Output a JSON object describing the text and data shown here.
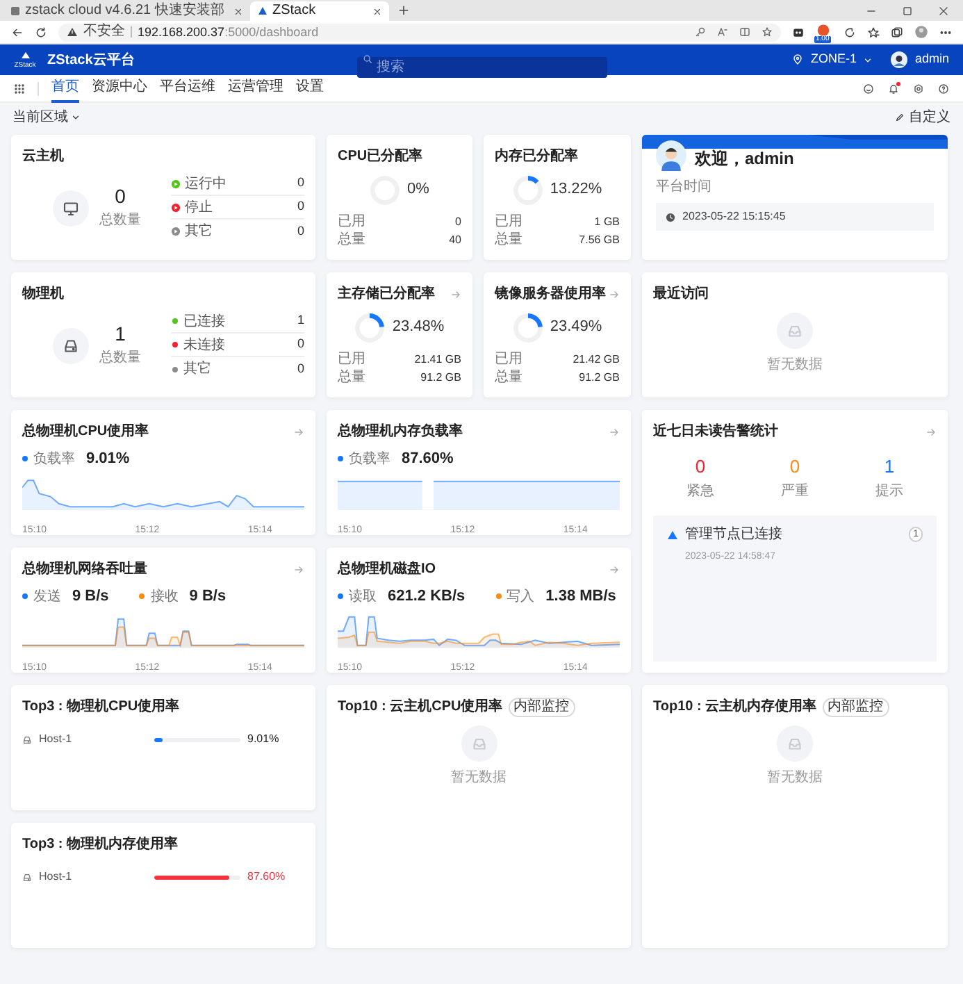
{
  "browser": {
    "tabs": [
      {
        "title": "zstack cloud v4.6.21 快速安装部",
        "selected": false
      },
      {
        "title": "ZStack",
        "selected": true
      }
    ],
    "security": "不安全",
    "url_host": "192.168.200.37",
    "url_path": ":5000/dashboard",
    "extension_badge": "1.00"
  },
  "header": {
    "logo_text": "ZStack",
    "product": "ZStack云平台",
    "search_placeholder": "搜索",
    "zone": "ZONE-1",
    "user": "admin",
    "unread_notifications": true
  },
  "nav": [
    {
      "label": "首页",
      "selected": true
    },
    {
      "label": "资源中心",
      "selected": false
    },
    {
      "label": "平台运维",
      "selected": false
    },
    {
      "label": "运营管理",
      "selected": false
    },
    {
      "label": "设置",
      "selected": false
    }
  ],
  "toolbar": {
    "region": "当前区域",
    "customize": "自定义"
  },
  "cards": [
    {
      "kind": "vm_summary",
      "title": "云主机",
      "total": "0",
      "total_label": "总数量",
      "statuses": [
        {
          "label": "运行中",
          "value": "0",
          "color": "#52c41a"
        },
        {
          "label": "停止",
          "value": "0",
          "color": "#f5222d"
        },
        {
          "label": "其它",
          "value": "0",
          "color": "#8c8c8c"
        }
      ]
    },
    {
      "kind": "allocation",
      "title": "CPU已分配率",
      "arrow": false,
      "level": 0,
      "percent": "0%",
      "rows": [
        {
          "label": "已用",
          "value": "0"
        },
        {
          "label": "总量",
          "value": "40"
        }
      ]
    },
    {
      "kind": "allocation",
      "title": "内存已分配率",
      "arrow": false,
      "level": 0.1322,
      "percent": "13.22%",
      "rows": [
        {
          "label": "已用",
          "value": "1 GB"
        },
        {
          "label": "总量",
          "value": "7.56 GB"
        }
      ]
    },
    {
      "kind": "welcome",
      "greeting": "欢迎，admin",
      "time_label": "平台时间",
      "time": "2023-05-22 15:15:45"
    },
    {
      "kind": "host_summary",
      "title": "物理机",
      "total": "1",
      "total_label": "总数量",
      "statuses": [
        {
          "label": "已连接",
          "value": "1",
          "color": "#52c41a"
        },
        {
          "label": "未连接",
          "value": "0",
          "color": "#f5222d"
        },
        {
          "label": "其它",
          "value": "0",
          "color": "#8c8c8c"
        }
      ]
    },
    {
      "kind": "allocation",
      "title": "主存储已分配率",
      "arrow": true,
      "level": 0.2348,
      "percent": "23.48%",
      "rows": [
        {
          "label": "已用",
          "value": "21.41 GB"
        },
        {
          "label": "总量",
          "value": "91.2 GB"
        }
      ]
    },
    {
      "kind": "allocation",
      "title": "镜像服务器使用率",
      "arrow": true,
      "level": 0.2349,
      "percent": "23.49%",
      "rows": [
        {
          "label": "已用",
          "value": "21.42 GB"
        },
        {
          "label": "总量",
          "value": "91.2 GB"
        }
      ]
    },
    {
      "kind": "empty",
      "title": "最近访问",
      "empty_text": "暂无数据"
    },
    {
      "kind": "line_chart",
      "title": "总物理机CPU使用率",
      "arrow": true,
      "legend": [
        {
          "label": "负载率",
          "value": "9.01%",
          "color": "#1677ff"
        }
      ],
      "axis_labels": [
        "15:10",
        "15:12",
        "15:14"
      ]
    },
    {
      "kind": "line_chart",
      "title": "总物理机内存负载率",
      "arrow": true,
      "legend": [
        {
          "label": "负载率",
          "value": "87.60%",
          "color": "#1677ff"
        }
      ],
      "axis_labels": [
        "15:10",
        "15:12",
        "15:14"
      ]
    },
    {
      "kind": "alerts",
      "title": "近七日未读告警统计",
      "arrow": true,
      "counts": [
        {
          "value": "0",
          "label": "紧急",
          "color": "#f5222d"
        },
        {
          "value": "0",
          "label": "严重",
          "color": "#fa8c16"
        },
        {
          "value": "1",
          "label": "提示",
          "color": "#1677ff"
        }
      ],
      "items": [
        {
          "text": "管理节点已连接",
          "time": "2023-05-22 14:58:47",
          "count": "1"
        }
      ]
    },
    {
      "kind": "line_chart",
      "title": "总物理机网络吞吐量",
      "arrow": true,
      "legend": [
        {
          "label": "发送",
          "value": "9 B/s",
          "color": "#1677ff"
        },
        {
          "label": "接收",
          "value": "9 B/s",
          "color": "#fa8c16"
        }
      ],
      "axis_labels": [
        "15:10",
        "15:12",
        "15:14"
      ]
    },
    {
      "kind": "line_chart",
      "title": "总物理机磁盘IO",
      "arrow": true,
      "legend": [
        {
          "label": "读取",
          "value": "621.2 KB/s",
          "color": "#1677ff"
        },
        {
          "label": "写入",
          "value": "1.38 MB/s",
          "color": "#fa8c16"
        }
      ],
      "axis_labels": [
        "15:10",
        "15:12",
        "15:14"
      ]
    },
    {
      "kind": "ranking",
      "title": "Top3 : 物理机CPU使用率",
      "rows": [
        {
          "name": "Host-1",
          "level": 0.0901,
          "value": "9.01%",
          "warning": false
        }
      ]
    },
    {
      "kind": "empty",
      "title": "Top10 : 云主机CPU使用率",
      "tag": "内部监控",
      "empty_text": "暂无数据"
    },
    {
      "kind": "empty",
      "title": "Top10 : 云主机内存使用率",
      "tag": "内部监控",
      "empty_text": "暂无数据"
    },
    {
      "kind": "ranking",
      "title": "Top3 : 物理机内存使用率",
      "rows": [
        {
          "name": "Host-1",
          "level": 0.876,
          "value": "87.60%",
          "warning": true
        }
      ]
    }
  ]
}
